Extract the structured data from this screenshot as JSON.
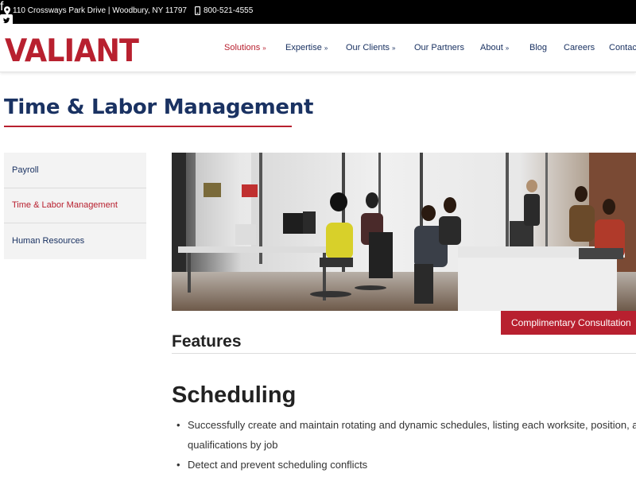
{
  "topbar": {
    "address": "110 Crossways Park Drive | Woodbury, NY 11797",
    "phone": "800-521-4555",
    "social": [
      {
        "icon": "facebook-icon"
      },
      {
        "icon": "twitter-icon"
      },
      {
        "icon": "linkedin-icon"
      },
      {
        "icon": "youtube-icon"
      }
    ]
  },
  "brand": {
    "logo_text": "VALIANT",
    "accent_color": "#b8202f",
    "navy_color": "#1a3262"
  },
  "nav": {
    "items": [
      {
        "label": "Solutions",
        "dropdown": true,
        "active": true
      },
      {
        "label": "Expertise",
        "dropdown": true
      },
      {
        "label": "Our Clients",
        "dropdown": true
      },
      {
        "label": "Our Partners"
      },
      {
        "label": "About",
        "dropdown": true
      },
      {
        "label": "Blog"
      },
      {
        "label": "Careers"
      },
      {
        "label": "Contac"
      }
    ]
  },
  "page": {
    "title": "Time & Labor Management"
  },
  "sidebar": {
    "items": [
      {
        "label": "Payroll"
      },
      {
        "label": "Time & Labor Management",
        "active": true
      },
      {
        "label": "Human Resources"
      }
    ]
  },
  "cta": {
    "label": "Complimentary Consultation"
  },
  "content": {
    "features_heading": "Features",
    "section_heading": "Scheduling",
    "bullets": [
      {
        "line1": "Successfully create and maintain rotating and dynamic schedules, listing each worksite, position, and",
        "line2": "qualifications by job"
      },
      {
        "line1": "Detect and prevent scheduling conflicts"
      }
    ]
  }
}
